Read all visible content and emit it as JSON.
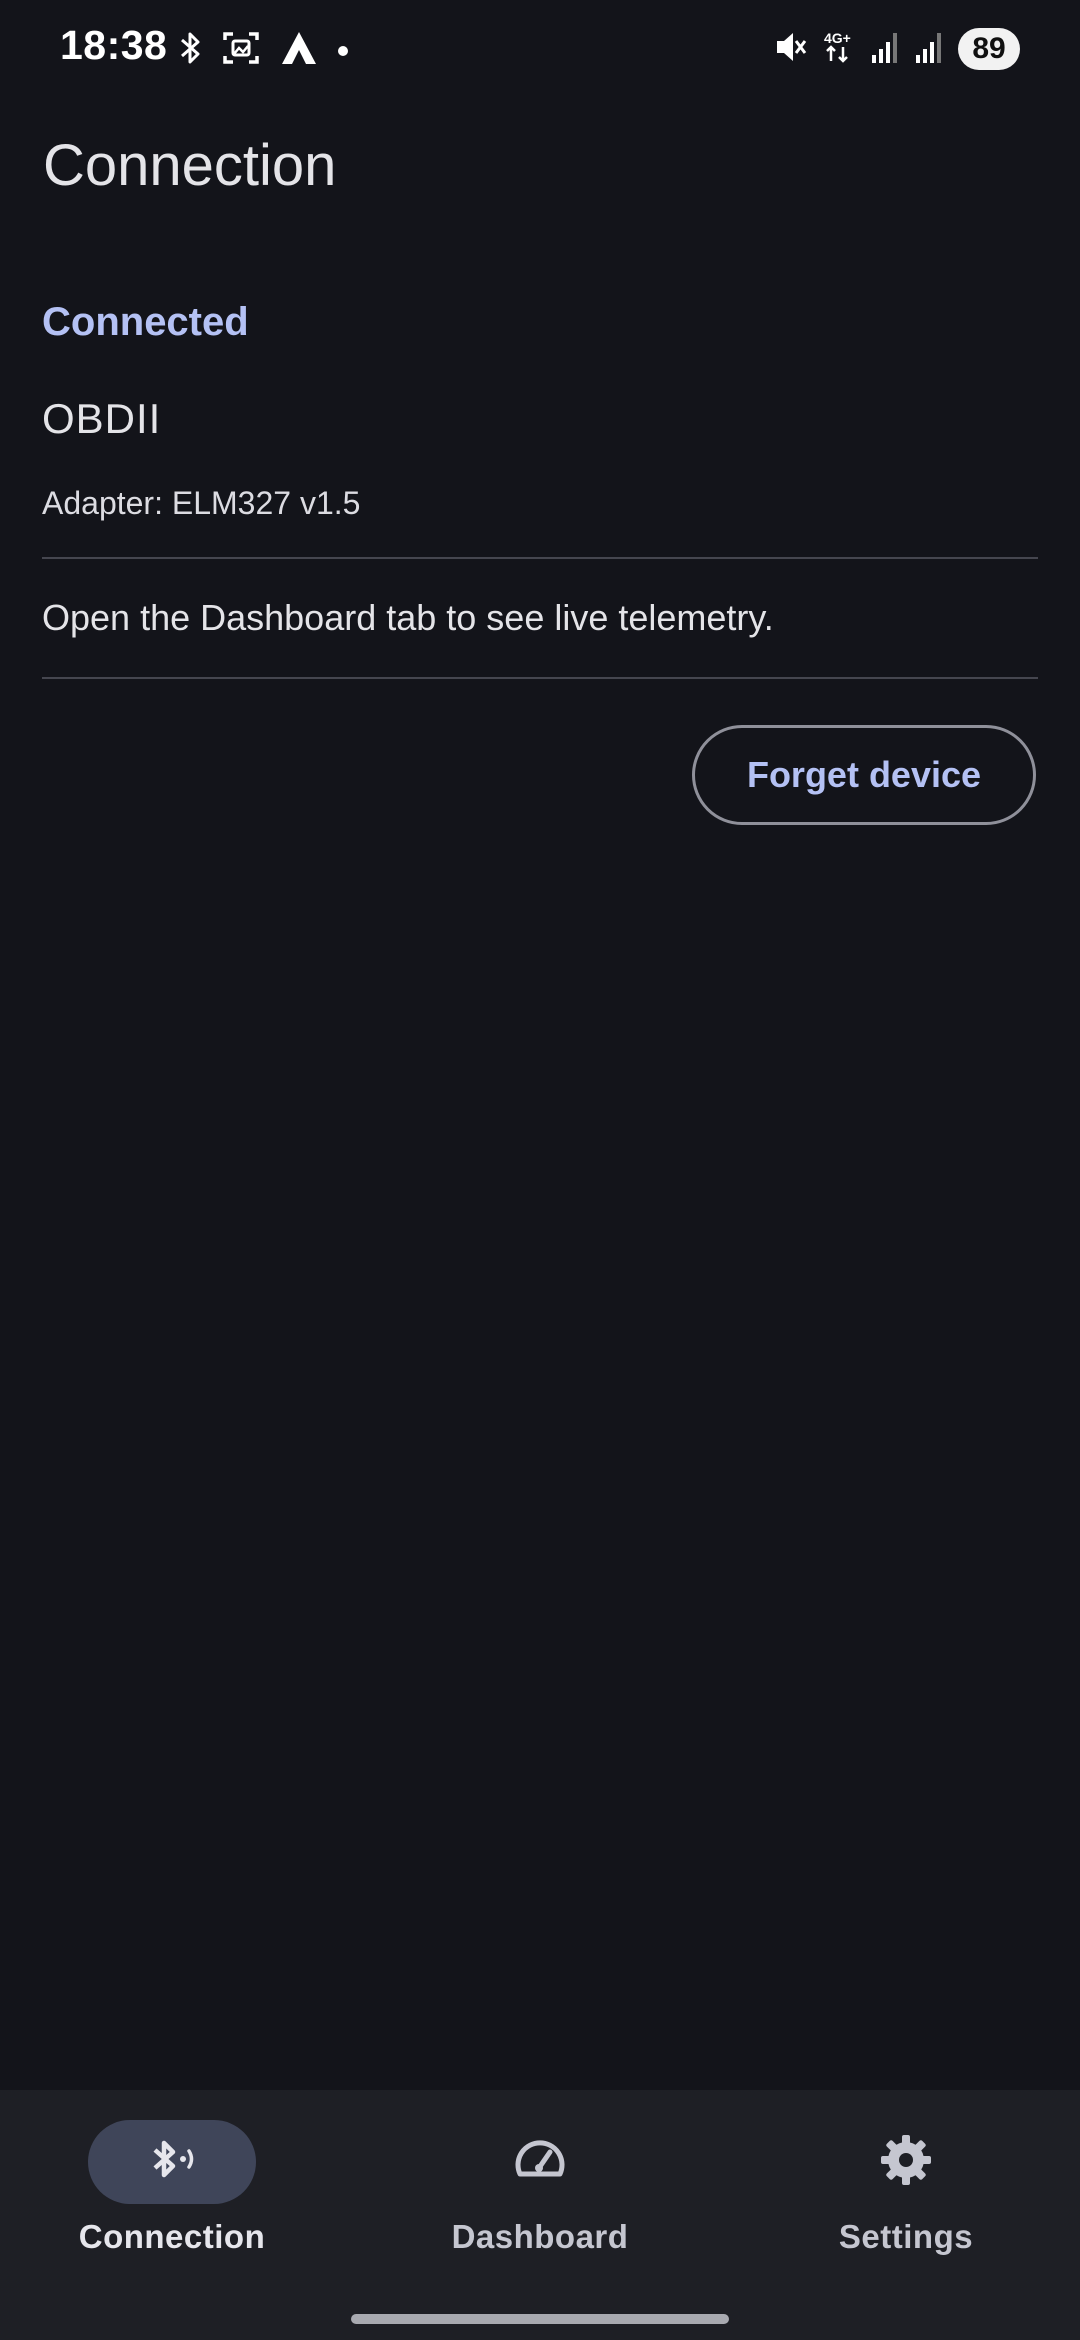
{
  "status_bar": {
    "time": "18:38",
    "battery": "89",
    "icons_left": [
      "bluetooth-icon",
      "screenshot-icon",
      "app-triangle-icon",
      "notification-dot-icon"
    ],
    "icons_right": [
      "mute-icon",
      "4g-plus-icon",
      "signal-icon",
      "signal-icon-2"
    ],
    "network_label": "4G+"
  },
  "page": {
    "title": "Connection"
  },
  "connection": {
    "status": "Connected",
    "device_name": "OBDII",
    "adapter": "Adapter: ELM327 v1.5",
    "hint": "Open the Dashboard tab to see live telemetry.",
    "forget_label": "Forget device"
  },
  "bottom_nav": {
    "items": [
      {
        "label": "Connection",
        "icon": "bluetooth-connected-icon",
        "active": true
      },
      {
        "label": "Dashboard",
        "icon": "speedometer-icon",
        "active": false
      },
      {
        "label": "Settings",
        "icon": "gear-icon",
        "active": false
      }
    ]
  },
  "colors": {
    "background": "#13141a",
    "accent": "#b4c1f4",
    "nav_background": "#1e1f25",
    "nav_active_pill": "#3f4559"
  }
}
